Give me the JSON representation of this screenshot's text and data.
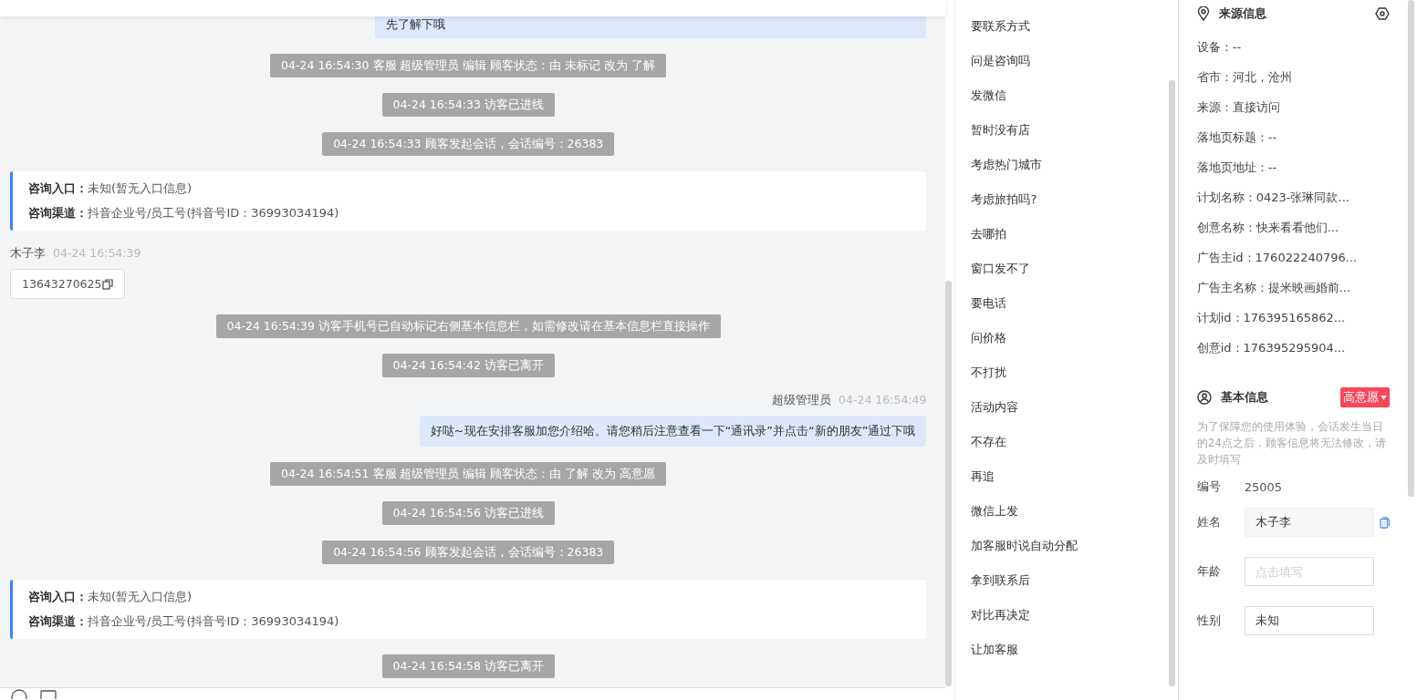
{
  "chat": {
    "messages": [
      {
        "kind": "agent_bubble",
        "text": "先了解下哦"
      },
      {
        "kind": "system",
        "text": "04-24 16:54:30 客服 超级管理员 编辑 顾客状态：由 未标记 改为 了解"
      },
      {
        "kind": "system",
        "text": "04-24 16:54:33 访客已进线"
      },
      {
        "kind": "system",
        "text": "04-24 16:54:33 顾客发起会话，会话编号：26383"
      },
      {
        "kind": "entry",
        "entry_label": "咨询入口：",
        "entry": "未知(暂无入口信息)",
        "channel_label": "咨询渠道：",
        "channel": "抖音企业号/员工号(抖音号ID：36993034194)"
      },
      {
        "kind": "visitor",
        "name": "木子李",
        "time": "04-24 16:54:39",
        "phone": "13643270625"
      },
      {
        "kind": "system",
        "text": "04-24 16:54:39 访客手机号已自动标记右侧基本信息栏，如需修改请在基本信息栏直接操作"
      },
      {
        "kind": "system",
        "text": "04-24 16:54:42 访客已离开"
      },
      {
        "kind": "agent",
        "name": "超级管理员",
        "time": "04-24 16:54:49",
        "text": "好哒~现在安排客服加您介绍哈。请您稍后注意查看一下“通讯录”并点击“新的朋友”通过下哦"
      },
      {
        "kind": "system",
        "text": "04-24 16:54:51 客服 超级管理员 编辑 顾客状态：由 了解 改为 高意愿"
      },
      {
        "kind": "system",
        "text": "04-24 16:54:56 访客已进线"
      },
      {
        "kind": "system",
        "text": "04-24 16:54:56 顾客发起会话，会话编号：26383"
      },
      {
        "kind": "entry",
        "entry_label": "咨询入口：",
        "entry": "未知(暂无入口信息)",
        "channel_label": "咨询渠道：",
        "channel": "抖音企业号/员工号(抖音号ID：36993034194)"
      },
      {
        "kind": "system",
        "text": "04-24 16:54:58 访客已离开"
      }
    ]
  },
  "quick_replies": [
    "要联系方式",
    "问是咨询吗",
    "发微信",
    "暂时没有店",
    "考虑热门城市",
    "考虑旅拍吗?",
    "去哪拍",
    "窗口发不了",
    "要电话",
    "问价格",
    "不打扰",
    "活动内容",
    "不存在",
    "再追",
    "微信上发",
    "加客服时说自动分配",
    "拿到联系后",
    "对比再决定",
    "让加客服"
  ],
  "source_info": {
    "title": "来源信息",
    "rows": [
      "设备：--",
      "省市：河北，沧州",
      "来源：直接访问",
      "落地页标题：--",
      "落地页地址：--",
      "计划名称：0423-张琳同款...",
      "创意名称：快来看看他们...",
      "广告主id：176022240796...",
      "广告主名称：提米映画婚前...",
      "计划id：176395165862...",
      "创意id：176395295904..."
    ]
  },
  "basic_info": {
    "title": "基本信息",
    "tag": "高意愿",
    "notice": "为了保障您的使用体验，会话发生当日的24点之后，顾客信息将无法修改，请及时填写",
    "fields": [
      {
        "kind": "text",
        "label": "编号",
        "value": "25005"
      },
      {
        "kind": "input",
        "label": "姓名",
        "value": "木子李",
        "disabled": true,
        "copyable": true
      },
      {
        "kind": "input",
        "label": "年龄",
        "placeholder": "点击填写",
        "disabled": false,
        "copyable": false
      },
      {
        "kind": "input",
        "label": "性别",
        "value": "未知",
        "disabled": false,
        "copyable": false
      }
    ]
  }
}
